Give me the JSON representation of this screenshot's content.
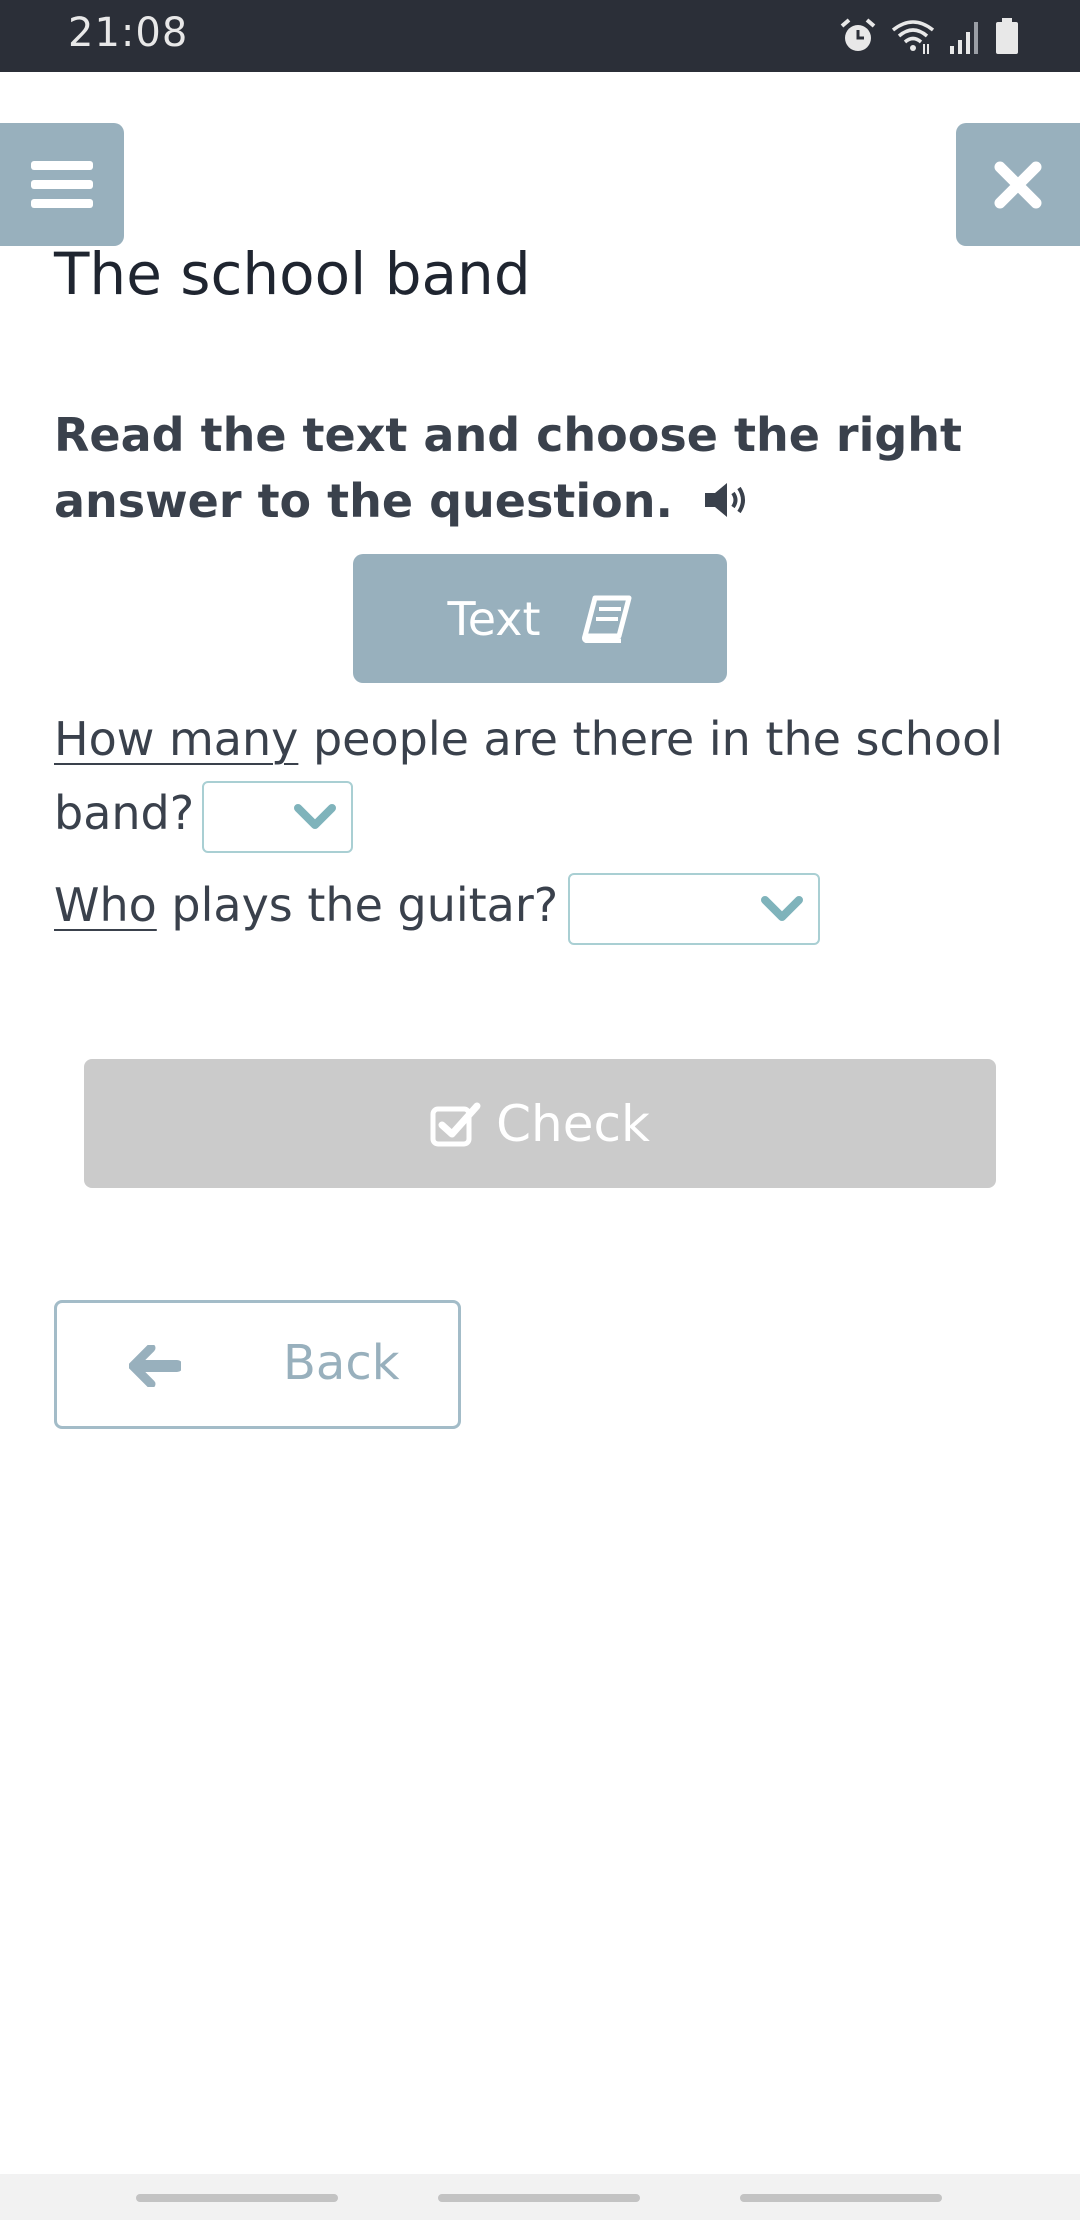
{
  "status_bar": {
    "time": "21:08",
    "icons": [
      "alarm-icon",
      "wifi-icon",
      "signal-icon",
      "battery-icon"
    ]
  },
  "header": {
    "menu_icon": "hamburger-icon",
    "close_icon": "close-icon"
  },
  "page": {
    "title": "The school band",
    "instruction": "Read the text and choose the right answer to the question.",
    "instruction_icon": "speaker-icon",
    "text_button": {
      "label": "Text",
      "icon": "book-icon"
    }
  },
  "questions": [
    {
      "highlight": "How many",
      "rest": " people are there in the school band?",
      "selected_value": ""
    },
    {
      "highlight": "Who",
      "rest": " plays the guitar?",
      "selected_value": ""
    }
  ],
  "actions": {
    "check_label": "Check",
    "check_icon": "checkbox-icon",
    "back_label": "Back",
    "back_icon": "arrow-left-icon"
  },
  "colors": {
    "accent": "#98b0bd",
    "dropdown_border": "#a9cfd3",
    "disabled_button": "#cbcbcb",
    "status_bar": "#2b2f38"
  }
}
